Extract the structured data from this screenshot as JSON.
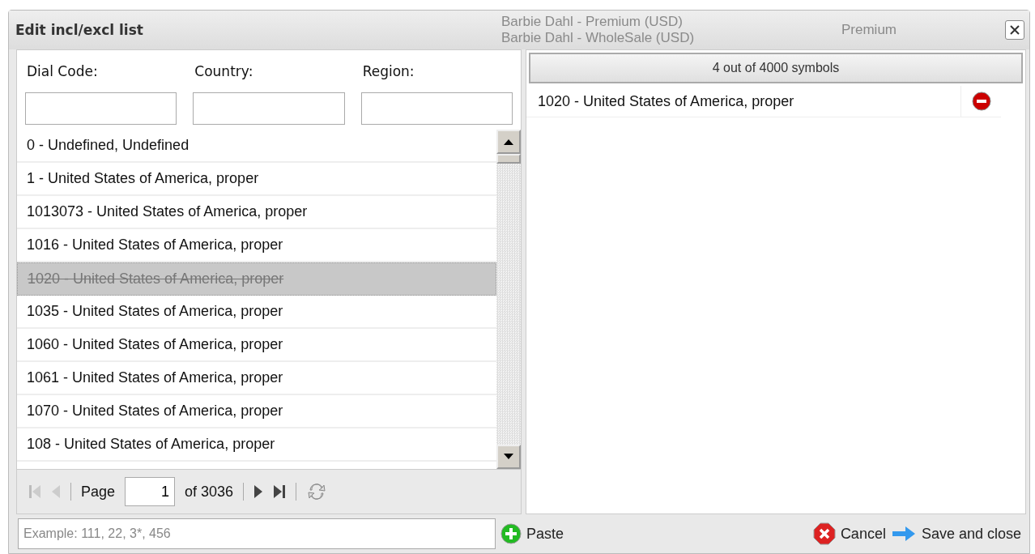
{
  "background_texts": [
    "Barbie Dahl - Premium (USD)",
    "Barbie Dahl - WholeSale (USD)",
    "Premium"
  ],
  "window": {
    "title": "Edit incl/excl list"
  },
  "filters": [
    {
      "label": "Dial Code:"
    },
    {
      "label": "Country:"
    },
    {
      "label": "Region:"
    }
  ],
  "list": [
    {
      "text": "0 - Undefined, Undefined",
      "added": false
    },
    {
      "text": "1 - United States of America, proper",
      "added": false
    },
    {
      "text": "1013073 - United States of America, proper",
      "added": false
    },
    {
      "text": "1016 - United States of America, proper",
      "added": false
    },
    {
      "text": "1020 - United States of America, proper",
      "added": true
    },
    {
      "text": "1035 - United States of America, proper",
      "added": false
    },
    {
      "text": "1060 - United States of America, proper",
      "added": false
    },
    {
      "text": "1061 - United States of America, proper",
      "added": false
    },
    {
      "text": "1070 - United States of America, proper",
      "added": false
    },
    {
      "text": "108 - United States of America, proper",
      "added": false
    }
  ],
  "pager": {
    "page_label": "Page",
    "page": "1",
    "of_label": "of 3036"
  },
  "selection": {
    "header": "4 out of 4000 symbols",
    "items": [
      "1020 - United States of America, proper"
    ]
  },
  "bottom": {
    "placeholder": "Example: 111, 22, 3*, 456",
    "paste": "Paste",
    "cancel": "Cancel",
    "save": "Save and close"
  }
}
